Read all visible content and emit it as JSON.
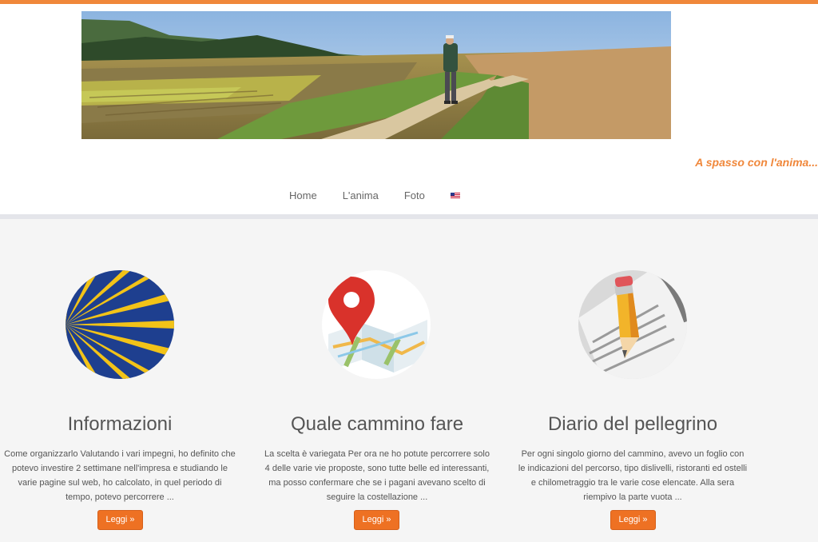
{
  "header": {
    "tagline": "A spasso con l'anima...",
    "banner_image": "pilgrim-walking-on-country-path-photo"
  },
  "nav": {
    "items": [
      {
        "label": "Home"
      },
      {
        "label": "L'anima"
      },
      {
        "label": "Foto"
      }
    ],
    "language_icon": "us-flag-icon"
  },
  "features": [
    {
      "icon": "camino-scallop-shell-icon",
      "title": "Informazioni",
      "text": "Come organizzarlo Valutando i vari impegni, ho definito che potevo investire 2 settimane nell'impresa e studiando le varie pagine sul web, ho calcolato, in quel periodo di tempo, potevo percorrere ...",
      "button": "Leggi »"
    },
    {
      "icon": "map-pin-icon",
      "title": "Quale cammino fare",
      "text": "La scelta è variegata   Per ora ne ho potute percorrere solo 4 delle varie vie proposte, sono tutte belle ed interessanti, ma posso confermare che se i pagani avevano scelto di seguire la costellazione ...",
      "button": "Leggi »"
    },
    {
      "icon": "pencil-notebook-icon",
      "title": "Diario del pellegrino",
      "text": "Per ogni singolo giorno del cammino, avevo un foglio con le indicazioni del percorso, tipo dislivelli, ristoranti ed ostelli e chilometraggio tra le varie cose elencate. Alla sera riempivo la parte vuota ...",
      "button": "Leggi »"
    }
  ],
  "colors": {
    "accent": "#f0873a",
    "button": "#ee7123",
    "main_bg": "#f5f5f5",
    "shell_blue": "#1e3f8f",
    "shell_yellow": "#f2c318",
    "pin_red": "#d9322b"
  }
}
